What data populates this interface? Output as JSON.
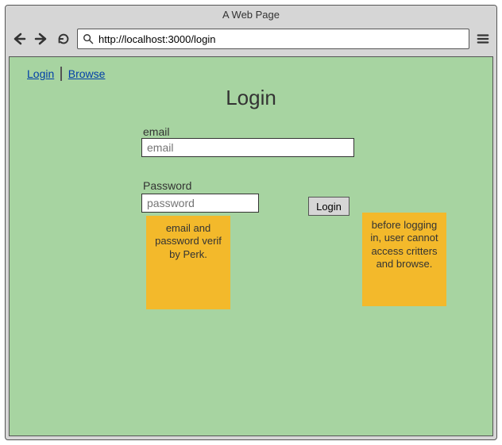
{
  "window": {
    "title": "A Web Page",
    "url": "http://localhost:3000/login"
  },
  "nav": {
    "login": "Login",
    "browse": "Browse"
  },
  "page": {
    "title": "Login"
  },
  "form": {
    "email_label": "email",
    "email_placeholder": "email",
    "password_label": "Password",
    "password_placeholder": "password",
    "login_button": "Login"
  },
  "notes": {
    "note1": "email and password verif by Perk.",
    "note2": "before logging in, user cannot access critters and browse."
  }
}
